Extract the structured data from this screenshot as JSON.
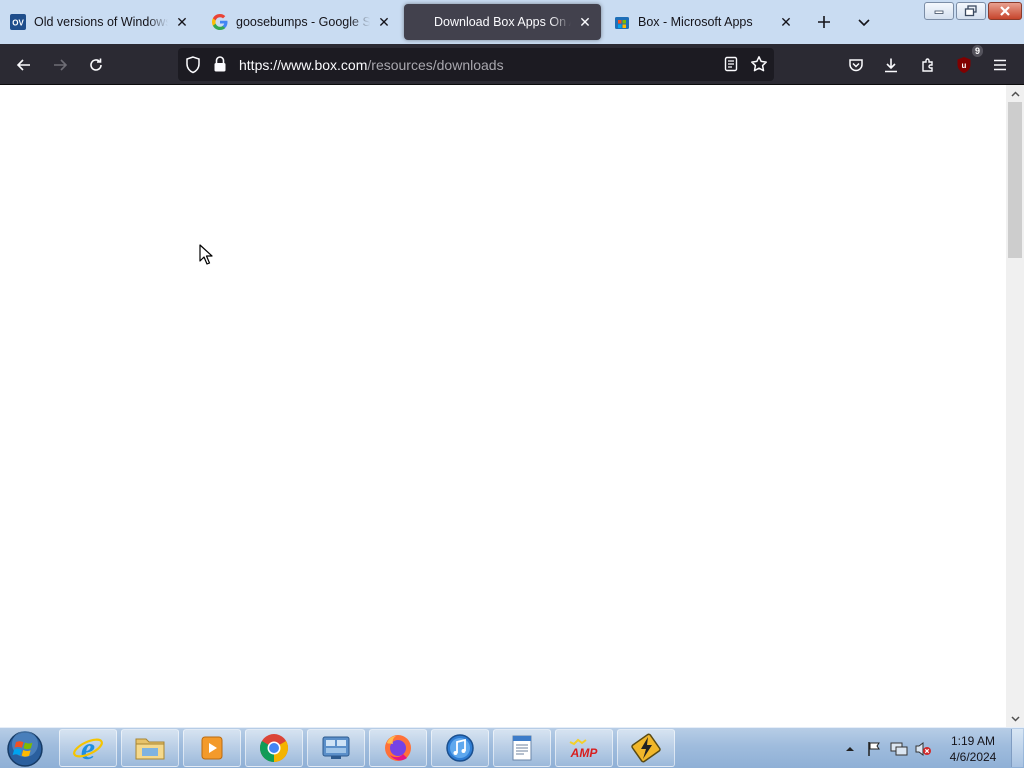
{
  "browser": {
    "tabs": [
      {
        "title": "Old versions of Windows, Li",
        "favicon": "oldversion-favicon",
        "favicon_text": "OV",
        "active": false
      },
      {
        "title": "goosebumps - Google Search",
        "favicon": "google-favicon",
        "active": false
      },
      {
        "title": "Download Box Apps On All Y",
        "favicon": "none",
        "active": true
      },
      {
        "title": "Box - Microsoft Apps",
        "favicon": "microsoft-store-favicon",
        "active": false
      }
    ],
    "new_tab_icon": "plus-icon",
    "tab_list_icon": "chevron-down-icon",
    "url_host": "https://www.box.com",
    "url_path": "/resources/downloads",
    "extension_badge": "9"
  },
  "window_controls": [
    "minimize",
    "restore",
    "close"
  ],
  "taskbar": {
    "apps": [
      "internet-explorer",
      "file-explorer",
      "media-player",
      "chrome",
      "control-panel",
      "firefox",
      "itunes",
      "wordpad",
      "winamp",
      "utility"
    ],
    "winamp_text": "AMP",
    "clock_time": "1:19 AM",
    "clock_date": "4/6/2024"
  },
  "colors": {
    "tabstrip": "#c9dcf2",
    "toolbar": "#2b2a33",
    "urlbar": "#1c1b22",
    "active_tab": "#42414d",
    "taskbar": "#9fbcdd",
    "content": "#ffffff"
  }
}
